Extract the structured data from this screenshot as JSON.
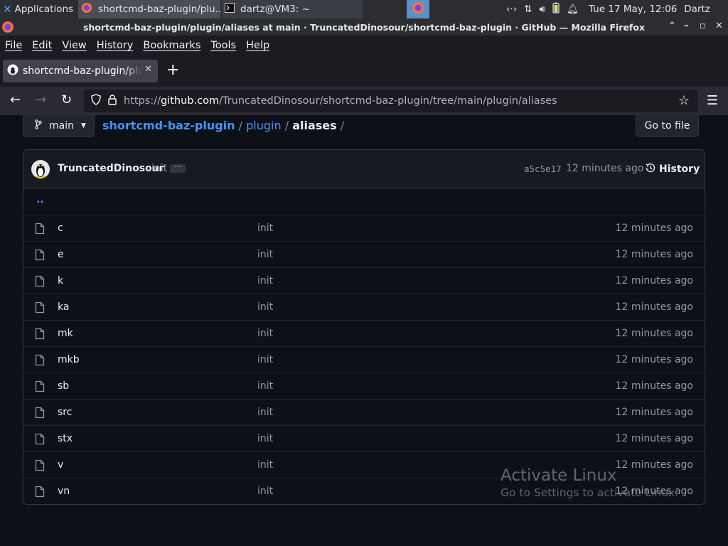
{
  "panel": {
    "apps_label": "Applications",
    "tasks": [
      {
        "label": "shortcmd-baz-plugin/plu…"
      },
      {
        "label": "dartz@VM3: ~"
      }
    ],
    "clock": "Tue 17 May, 12:06",
    "user": "Dartz"
  },
  "window": {
    "title": "shortcmd-baz-plugin/plugin/aliases at main · TruncatedDinosour/shortcmd-baz-plugin · GitHub — Mozilla Firefox"
  },
  "menubar": [
    "File",
    "Edit",
    "View",
    "History",
    "Bookmarks",
    "Tools",
    "Help"
  ],
  "tab": {
    "label": "shortcmd-baz-plugin/plugin/aliases"
  },
  "urlbar": {
    "scheme": "https://",
    "host": "github.com",
    "path": "/TruncatedDinosour/shortcmd-baz-plugin/tree/main/plugin/aliases"
  },
  "repo": {
    "branch": "main",
    "breadcrumb": {
      "repo": "shortcmd-baz-plugin",
      "sep": "/",
      "dir": "plugin",
      "current": "aliases",
      "trail": "/"
    },
    "goto_file": "Go to file"
  },
  "commit": {
    "author": "TruncatedDinosour",
    "message": "init",
    "sha": "a5c5e17",
    "age": "12 minutes ago",
    "history_label": "History"
  },
  "parent_dir": "..",
  "files": [
    {
      "name": "c",
      "message": "init",
      "age": "12 minutes ago"
    },
    {
      "name": "e",
      "message": "init",
      "age": "12 minutes ago"
    },
    {
      "name": "k",
      "message": "init",
      "age": "12 minutes ago"
    },
    {
      "name": "ka",
      "message": "init",
      "age": "12 minutes ago"
    },
    {
      "name": "mk",
      "message": "init",
      "age": "12 minutes ago"
    },
    {
      "name": "mkb",
      "message": "init",
      "age": "12 minutes ago"
    },
    {
      "name": "sb",
      "message": "init",
      "age": "12 minutes ago"
    },
    {
      "name": "src",
      "message": "init",
      "age": "12 minutes ago"
    },
    {
      "name": "stx",
      "message": "init",
      "age": "12 minutes ago"
    },
    {
      "name": "v",
      "message": "init",
      "age": "12 minutes ago"
    },
    {
      "name": "vn",
      "message": "init",
      "age": "12 minutes ago"
    }
  ],
  "watermark": {
    "heading": "Activate Linux",
    "sub": "Go to Settings to activate Linux."
  },
  "colors": {
    "bg": "#0d1117",
    "link": "#4493f8",
    "muted": "#9198a1",
    "border": "#30363d"
  }
}
